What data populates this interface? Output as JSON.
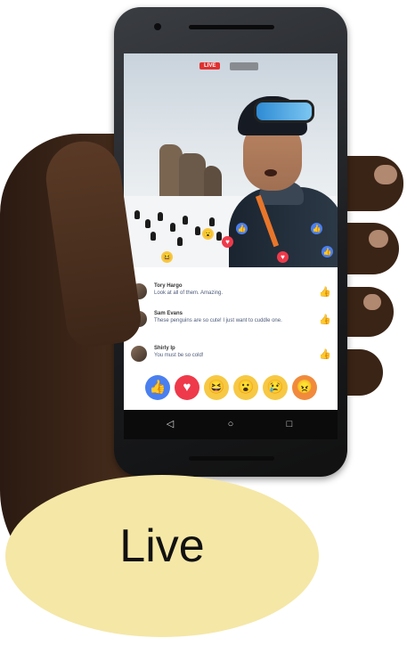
{
  "stream": {
    "live_badge": "LIVE"
  },
  "comments": [
    {
      "name": "Tory Hargo",
      "text": "Look at all of them. Amazing."
    },
    {
      "name": "Sam Evans",
      "text": "These penguins are so cute! I just want to cuddle one."
    },
    {
      "name": "Shirly Ip",
      "text": "You must be so cold!"
    }
  ],
  "reactions": [
    {
      "name": "like",
      "glyph": "👍",
      "color": "#4a7ff0"
    },
    {
      "name": "love",
      "glyph": "♥",
      "color": "#ee3a4a"
    },
    {
      "name": "haha",
      "glyph": "😆",
      "color": "#f7c843"
    },
    {
      "name": "wow",
      "glyph": "😮",
      "color": "#f7c843"
    },
    {
      "name": "sad",
      "glyph": "😢",
      "color": "#f7c843"
    },
    {
      "name": "angry",
      "glyph": "😠",
      "color": "#f18a3c"
    }
  ],
  "navigation": {
    "back_glyph": "◁",
    "home_glyph": "○",
    "recents_glyph": "□"
  },
  "caption": {
    "label": "Live"
  },
  "colors": {
    "caption_bg": "#f5e7a6",
    "live_red": "#e0312f",
    "like_blue": "#4a7ff0"
  }
}
